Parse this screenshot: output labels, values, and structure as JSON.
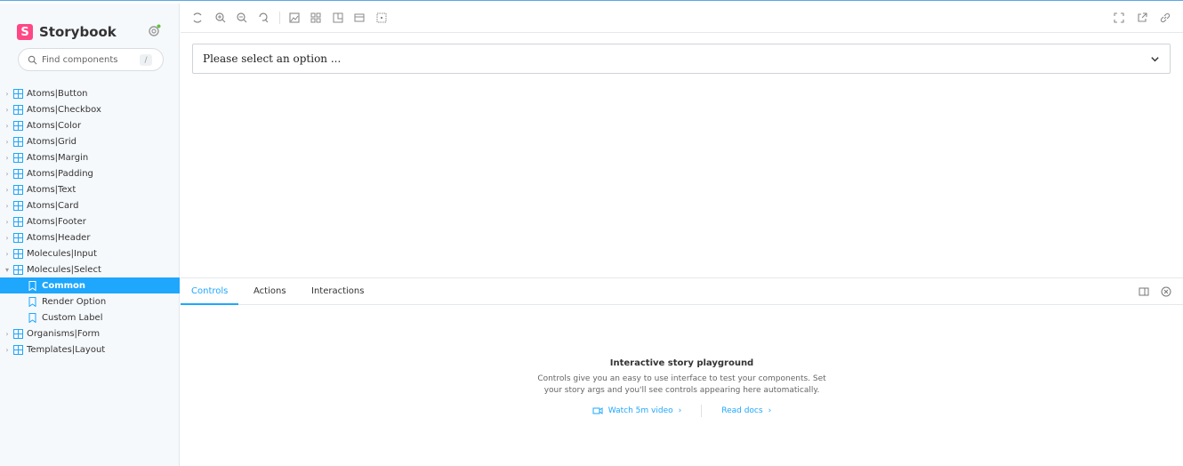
{
  "colors": {
    "accent": "#1ea7fd",
    "brand": "#ff4785",
    "sidebar_bg": "#f6f9fc"
  },
  "sidebar": {
    "brand": {
      "logo_letter": "S",
      "title": "Storybook"
    },
    "search": {
      "placeholder": "Find components",
      "shortcut": "/"
    },
    "items": [
      {
        "label": "Atoms|Button",
        "type": "component"
      },
      {
        "label": "Atoms|Checkbox",
        "type": "component"
      },
      {
        "label": "Atoms|Color",
        "type": "component"
      },
      {
        "label": "Atoms|Grid",
        "type": "component"
      },
      {
        "label": "Atoms|Margin",
        "type": "component"
      },
      {
        "label": "Atoms|Padding",
        "type": "component"
      },
      {
        "label": "Atoms|Text",
        "type": "component"
      },
      {
        "label": "Atoms|Card",
        "type": "component"
      },
      {
        "label": "Atoms|Footer",
        "type": "component"
      },
      {
        "label": "Atoms|Header",
        "type": "component"
      },
      {
        "label": "Molecules|Input",
        "type": "component"
      },
      {
        "label": "Molecules|Select",
        "type": "component",
        "expanded": true
      },
      {
        "label": "Common",
        "type": "story",
        "selected": true
      },
      {
        "label": "Render Option",
        "type": "story"
      },
      {
        "label": "Custom Label",
        "type": "story"
      },
      {
        "label": "Organisms|Form",
        "type": "component"
      },
      {
        "label": "Templates|Layout",
        "type": "component"
      }
    ]
  },
  "toolbar": {
    "icons": [
      "sync-icon",
      "zoom-in-icon",
      "zoom-out-icon",
      "zoom-reset-icon",
      "background-icon",
      "grid-icon",
      "viewport-icon",
      "measure-icon",
      "outline-icon"
    ],
    "right_icons": [
      "fullscreen-icon",
      "share-icon",
      "link-icon"
    ]
  },
  "canvas": {
    "select": {
      "value": "Please select an option ..."
    }
  },
  "panel": {
    "tabs": [
      "Controls",
      "Actions",
      "Interactions"
    ],
    "active_tab": "Controls",
    "empty": {
      "title": "Interactive story playground",
      "line1": "Controls give you an easy to use interface to test your components. Set",
      "line2": "your story args and you'll see controls appearing here automatically.",
      "video_link": "Watch 5m video",
      "docs_link": "Read docs"
    }
  }
}
